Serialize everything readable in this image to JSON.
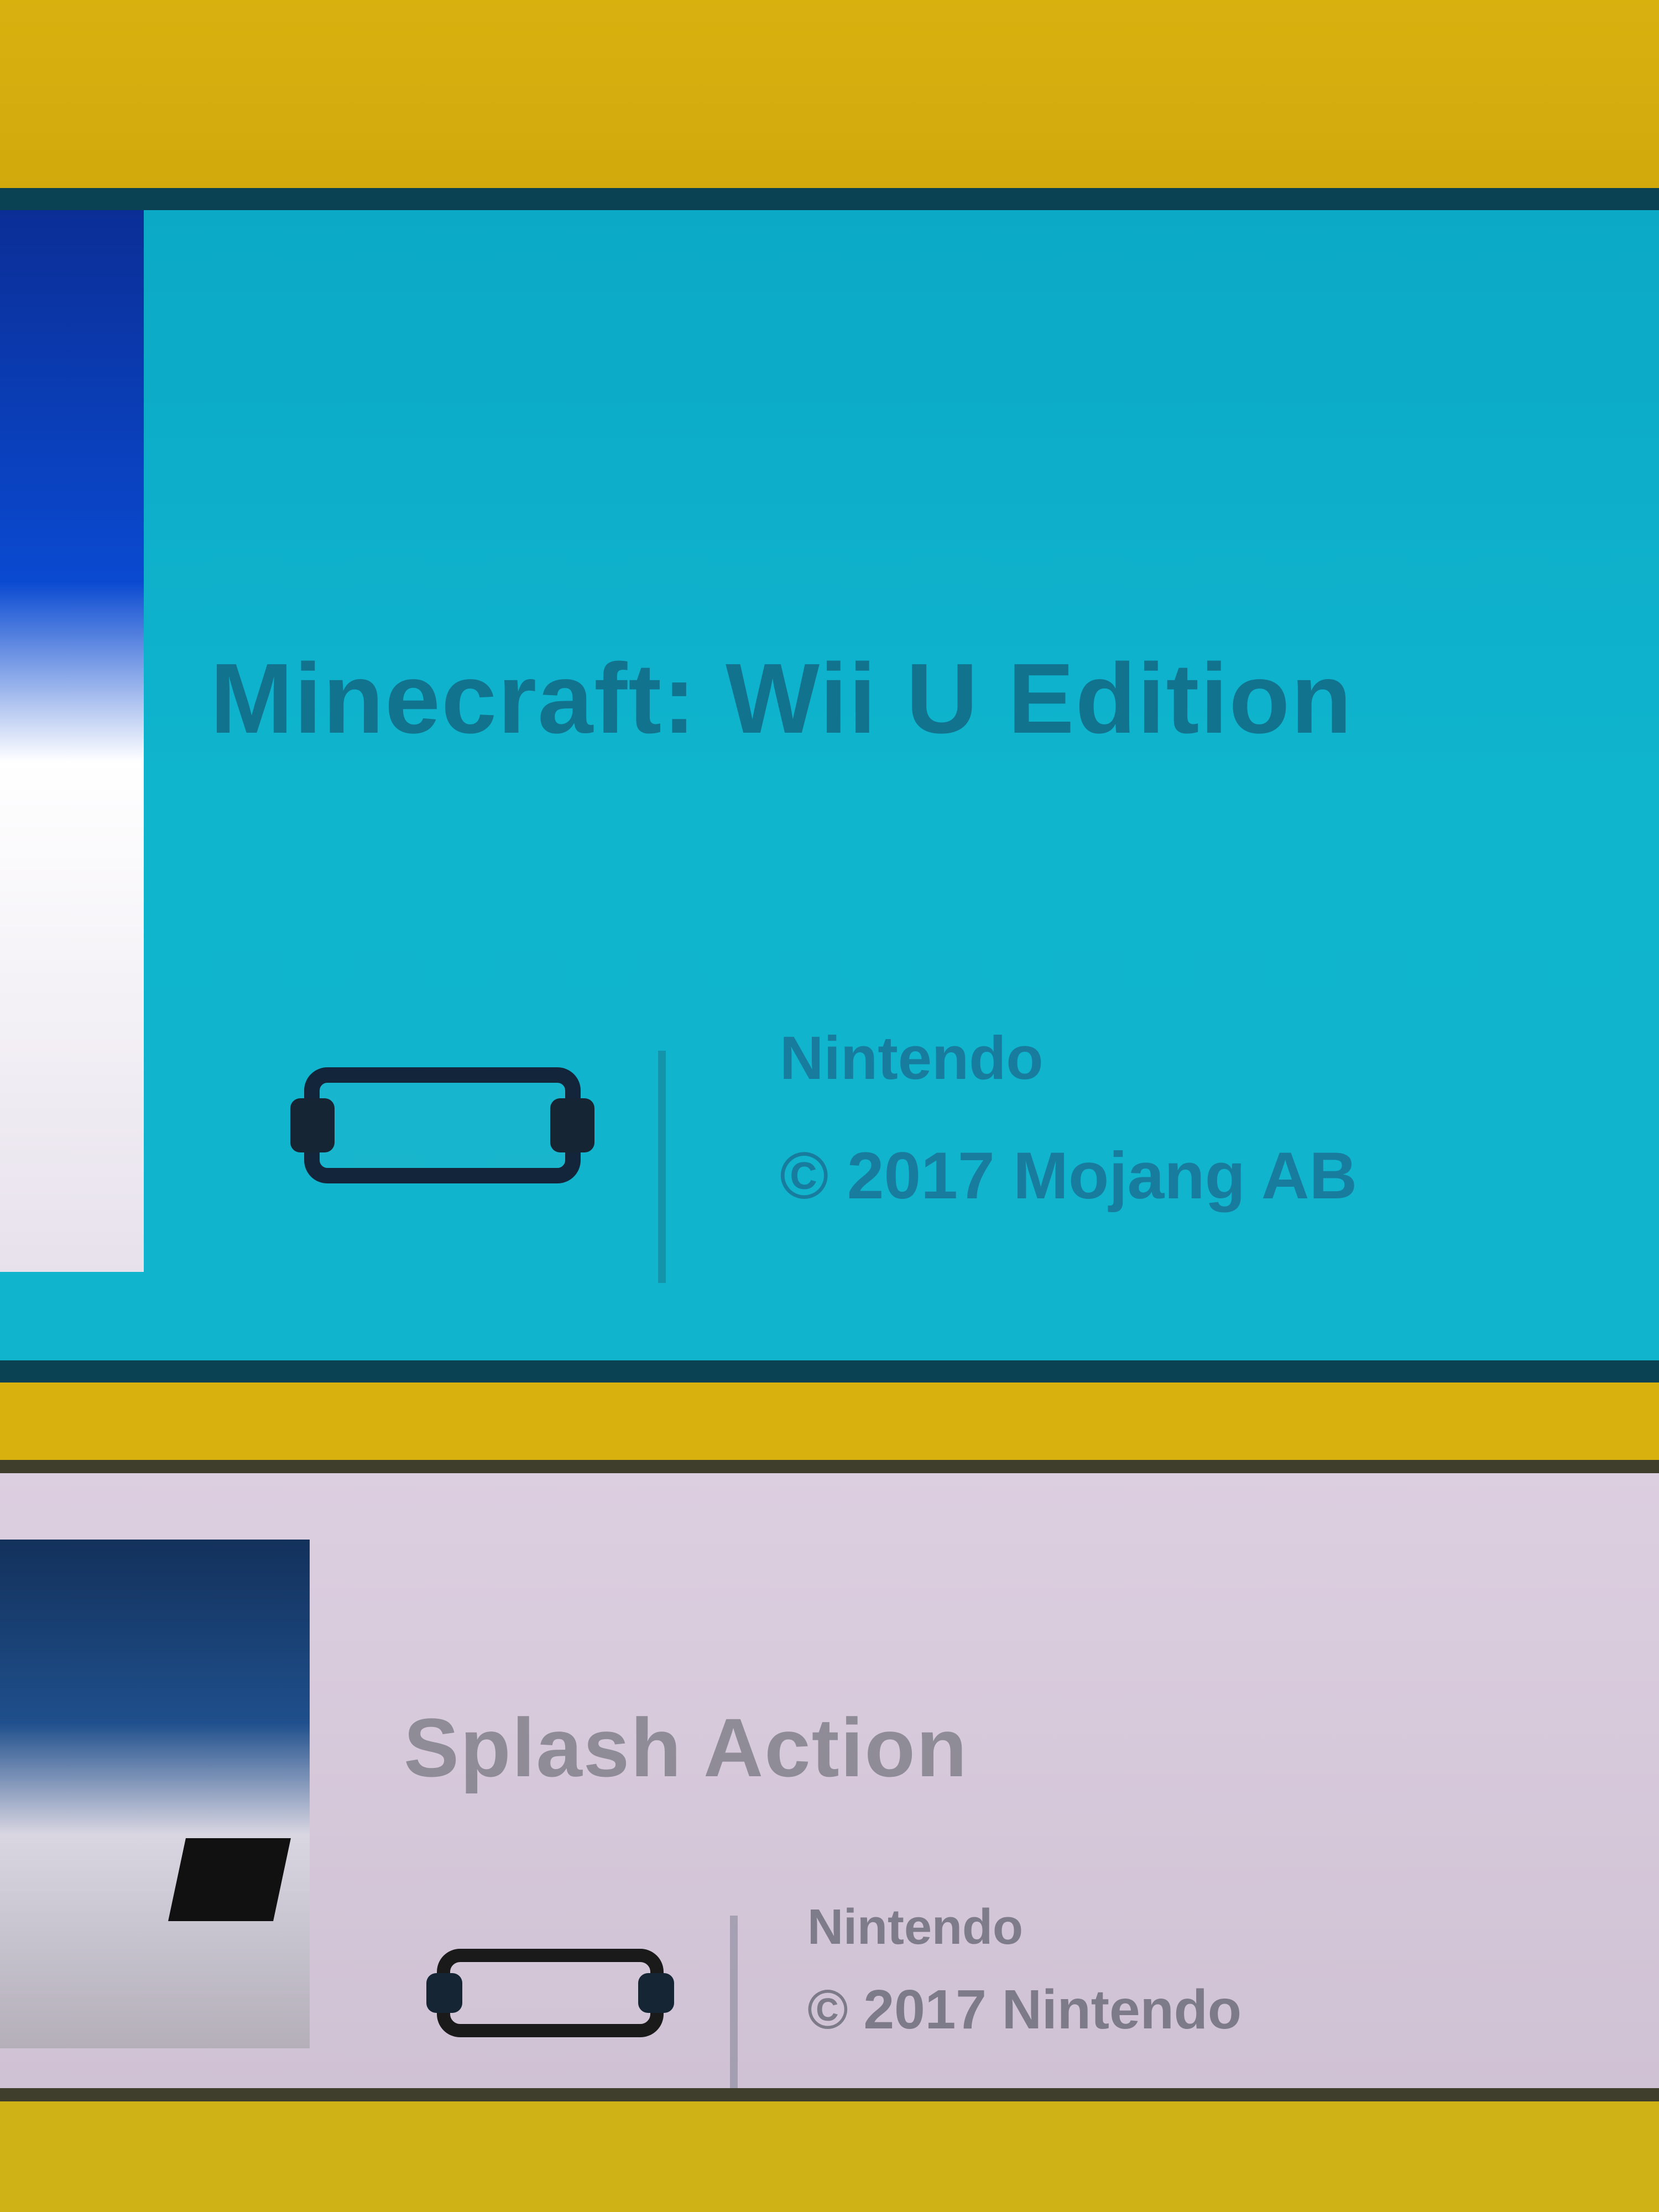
{
  "games": [
    {
      "title": "Minecraft: Wii U Edition",
      "publisher_line": "Nintendo",
      "copyright_line": "© 2017 Mojang AB",
      "tile_color": "#10b4cd",
      "console_icon": "console-icon"
    },
    {
      "title": "Splash Action",
      "publisher_line": "Nintendo",
      "copyright_line": "© 2017 Nintendo",
      "tile_color": "#dccfe0",
      "console_icon": "console-icon"
    }
  ]
}
